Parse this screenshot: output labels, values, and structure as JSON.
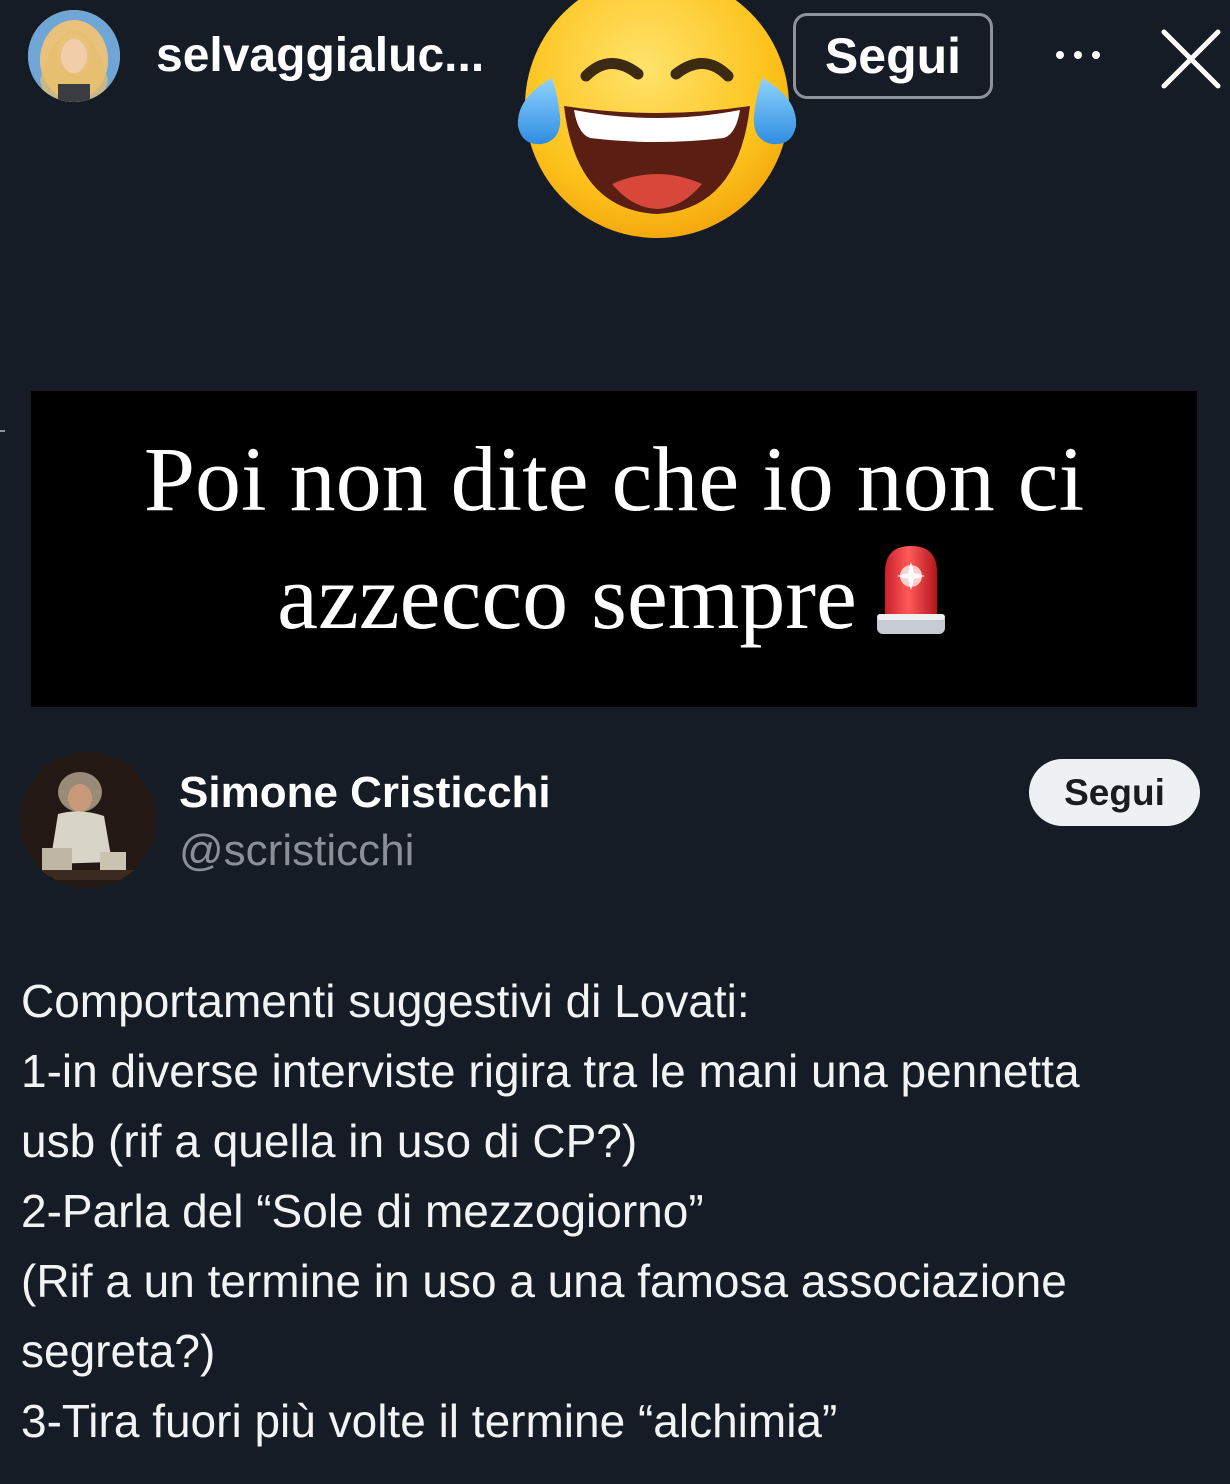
{
  "story": {
    "username": "selvaggialuc...",
    "follow_label": "Segui",
    "more_icon": "ellipsis-icon",
    "close_icon": "close-icon",
    "sticker": "face-with-tears-of-joy-emoji"
  },
  "caption": {
    "line1": "Poi non dite che io non ci",
    "line2": "azzecco sempre",
    "emoji": "police-car-light-emoji"
  },
  "tweet": {
    "author_name": "Simone Cristicchi",
    "author_handle": "@scristicchi",
    "follow_label": "Segui",
    "lines": [
      "Comportamenti  suggestivi di Lovati:",
      "1-in diverse interviste rigira tra le mani una pennetta",
      "usb (rif a quella in uso di CP?)",
      "2-Parla del “Sole di mezzogiorno”",
      "(Rif a un termine in uso a una famosa associazione",
      "segreta?)",
      "3-Tira fuori più volte il termine “alchimia”"
    ]
  },
  "colors": {
    "background": "#161c26",
    "caption_bg": "#000000",
    "text": "#ffffff",
    "handle": "#8a8f98",
    "pill_bg": "#eef1f4"
  }
}
